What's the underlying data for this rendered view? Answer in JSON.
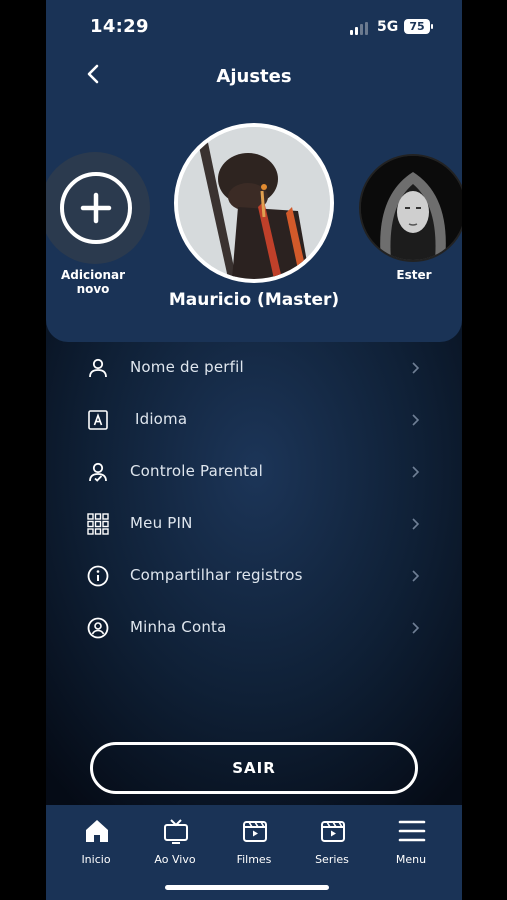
{
  "status_bar": {
    "time": "14:29",
    "network": "5G",
    "battery": "75"
  },
  "header": {
    "title": "Ajustes",
    "back_icon": "chevron-left-icon"
  },
  "profiles": {
    "add_label": "Adicionar novo",
    "add_icon": "plus-icon",
    "active_name": "Mauricio (Master)",
    "others": [
      {
        "name": "Ester"
      }
    ]
  },
  "menu": {
    "items": [
      {
        "label": "Nome de perfil",
        "icon": "user-icon"
      },
      {
        "label": " Idioma",
        "icon": "language-icon"
      },
      {
        "label": "Controle Parental",
        "icon": "parental-control-icon"
      },
      {
        "label": "Meu PIN",
        "icon": "keypad-icon"
      },
      {
        "label": "Compartilhar registros",
        "icon": "info-icon"
      },
      {
        "label": "Minha Conta",
        "icon": "account-icon"
      }
    ]
  },
  "logout": {
    "label": "SAIR"
  },
  "tabs": [
    {
      "label": "Inicio",
      "icon": "home-icon",
      "active": true
    },
    {
      "label": "Ao Vivo",
      "icon": "tv-icon"
    },
    {
      "label": "Filmes",
      "icon": "movies-icon"
    },
    {
      "label": "Series",
      "icon": "series-icon"
    },
    {
      "label": "Menu",
      "icon": "hamburger-menu-icon"
    }
  ],
  "colors": {
    "header_bg": "#1a3356",
    "tab_bar_bg": "#1a3356",
    "background_dark": "#050b16",
    "text": "#ffffff"
  }
}
